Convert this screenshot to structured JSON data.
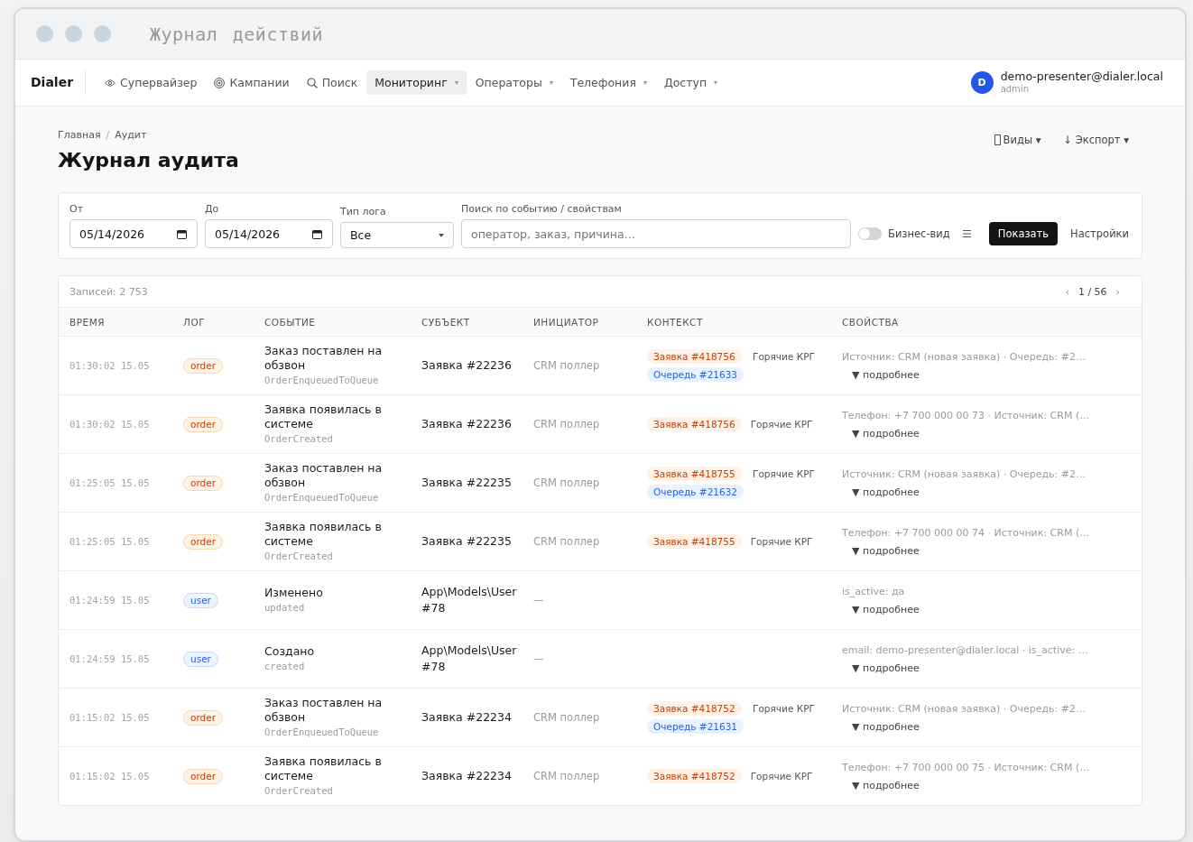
{
  "window": {
    "title": "Журнал действий"
  },
  "nav": {
    "brand": "Dialer",
    "items": [
      {
        "label": "Супервайзер",
        "kind": "eye",
        "selected": false
      },
      {
        "label": "Кампании",
        "kind": "target",
        "selected": false
      },
      {
        "label": "Поиск",
        "kind": "search",
        "selected": false
      },
      {
        "label": "Мониторинг",
        "kind": "menu",
        "selected": true
      },
      {
        "label": "Операторы",
        "kind": "menu",
        "selected": false
      },
      {
        "label": "Телефония",
        "kind": "menu",
        "selected": false
      },
      {
        "label": "Доступ",
        "kind": "menu",
        "selected": false
      }
    ],
    "user": {
      "initial": "D",
      "email": "demo-presenter@dialer.local",
      "role": "admin"
    }
  },
  "breadcrumbs": [
    "Главная",
    "Аудит"
  ],
  "breadcrumb_separator": "/",
  "page_title": "Журнал аудита",
  "header_actions": [
    {
      "label": "Виды ▾",
      "kind": "views"
    },
    {
      "label": "↓ Экспорт ▾",
      "kind": "export"
    }
  ],
  "filters": {
    "from": {
      "label": "От",
      "value": "05/14/2026"
    },
    "to": {
      "label": "До",
      "value": "05/14/2026"
    },
    "log_type": {
      "label": "Тип лога",
      "value": "Все"
    },
    "search": {
      "label": "Поиск по событию / свойствам",
      "placeholder": "оператор, заказ, причина…"
    },
    "business_view": {
      "label": "Бизнес-вид",
      "on": false
    },
    "submit": "Показать",
    "settings": "Настройки"
  },
  "table": {
    "count": "Записей: 2 753",
    "pager": {
      "prev": "‹",
      "page": "1 / 56",
      "next": "›"
    },
    "columns": [
      "ВРЕМЯ",
      "ЛОГ",
      "СОБЫТИЕ",
      "СУБЪЕКТ",
      "ИНИЦИАТОР",
      "КОНТЕКСТ",
      "СВОЙСТВА"
    ],
    "rows": [
      {
        "time": "01:30:02 15.05",
        "log": {
          "label": "order",
          "kind": "order"
        },
        "event": "Заказ поставлен на обзвон",
        "code": "OrderEnqueuedToQueue",
        "subject": "Заявка #22236",
        "initiator": "CRM поллер",
        "context": [
          {
            "label": "Заявка #418756",
            "kind": "order"
          },
          {
            "label": "Очередь #21633",
            "kind": "queue"
          }
        ],
        "context_note": "Горячие КРГ",
        "properties": "Источник: CRM (новая заявка) · Очередь: #2…",
        "details": "▼ подробнее"
      },
      {
        "time": "01:30:02 15.05",
        "log": {
          "label": "order",
          "kind": "order"
        },
        "event": "Заявка появилась в системе",
        "code": "OrderCreated",
        "subject": "Заявка #22236",
        "initiator": "CRM поллер",
        "context": [
          {
            "label": "Заявка #418756",
            "kind": "order"
          }
        ],
        "context_note": "Горячие КРГ",
        "properties": "Телефон: +7 700 000 00 73 · Источник: CRM (…",
        "details": "▼ подробнее"
      },
      {
        "time": "01:25:05 15.05",
        "log": {
          "label": "order",
          "kind": "order"
        },
        "event": "Заказ поставлен на обзвон",
        "code": "OrderEnqueuedToQueue",
        "subject": "Заявка #22235",
        "initiator": "CRM поллер",
        "context": [
          {
            "label": "Заявка #418755",
            "kind": "order"
          },
          {
            "label": "Очередь #21632",
            "kind": "queue"
          }
        ],
        "context_note": "Горячие КРГ",
        "properties": "Источник: CRM (новая заявка) · Очередь: #2…",
        "details": "▼ подробнее"
      },
      {
        "time": "01:25:05 15.05",
        "log": {
          "label": "order",
          "kind": "order"
        },
        "event": "Заявка появилась в системе",
        "code": "OrderCreated",
        "subject": "Заявка #22235",
        "initiator": "CRM поллер",
        "context": [
          {
            "label": "Заявка #418755",
            "kind": "order"
          }
        ],
        "context_note": "Горячие КРГ",
        "properties": "Телефон: +7 700 000 00 74 · Источник: CRM (…",
        "details": "▼ подробнее"
      },
      {
        "time": "01:24:59 15.05",
        "log": {
          "label": "user",
          "kind": "user"
        },
        "event": "Изменено",
        "code": "updated",
        "subject": "App\\Models\\User #78",
        "initiator": "—",
        "properties": "is_active: да",
        "details": "▼ подробнее"
      },
      {
        "time": "01:24:59 15.05",
        "log": {
          "label": "user",
          "kind": "user"
        },
        "event": "Создано",
        "code": "created",
        "subject": "App\\Models\\User #78",
        "initiator": "—",
        "properties": "email: demo-presenter@dialer.local · is_active: …",
        "details": "▼ подробнее"
      },
      {
        "time": "01:15:02 15.05",
        "log": {
          "label": "order",
          "kind": "order"
        },
        "event": "Заказ поставлен на обзвон",
        "code": "OrderEnqueuedToQueue",
        "subject": "Заявка #22234",
        "initiator": "CRM поллер",
        "context": [
          {
            "label": "Заявка #418752",
            "kind": "order"
          },
          {
            "label": "Очередь #21631",
            "kind": "queue"
          }
        ],
        "context_note": "Горячие КРГ",
        "properties": "Источник: CRM (новая заявка) · Очередь: #2…",
        "details": "▼ подробнее"
      },
      {
        "time": "01:15:02 15.05",
        "log": {
          "label": "order",
          "kind": "order"
        },
        "event": "Заявка появилась в системе",
        "code": "OrderCreated",
        "subject": "Заявка #22234",
        "initiator": "CRM поллер",
        "context": [
          {
            "label": "Заявка #418752",
            "kind": "order"
          }
        ],
        "context_note": "Горячие КРГ",
        "properties": "Телефон: +7 700 000 00 75 · Источник: CRM (…",
        "details": "▼ подробнее"
      }
    ]
  }
}
